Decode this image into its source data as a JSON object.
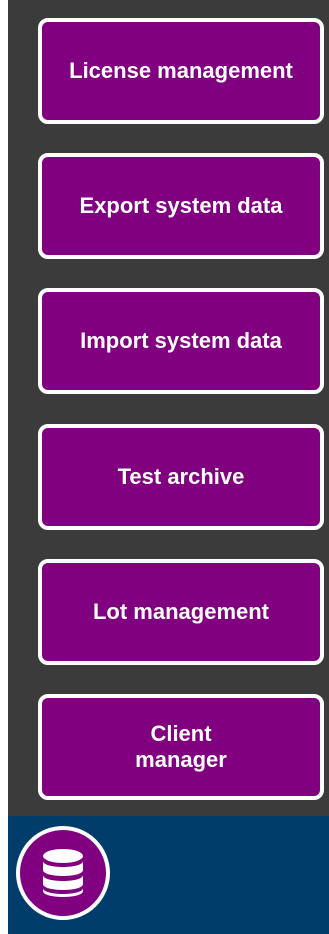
{
  "menu": {
    "items": [
      {
        "label": "License management"
      },
      {
        "label": "Export system data"
      },
      {
        "label": "Import system data"
      },
      {
        "label": "Test archive"
      },
      {
        "label": "Lot management"
      },
      {
        "label": "Client\nmanager"
      }
    ]
  },
  "footer": {
    "icon": "database-icon"
  },
  "colors": {
    "panel_bg": "#3b3b3b",
    "button_bg": "#800080",
    "button_border": "#ffffff",
    "footer_bg": "#003d6b"
  }
}
